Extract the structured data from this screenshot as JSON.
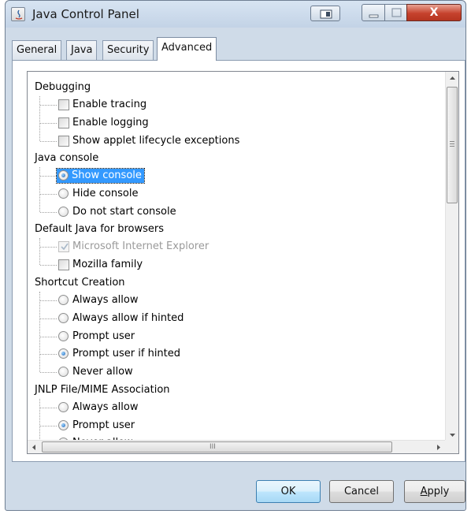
{
  "window": {
    "title": "Java Control Panel",
    "close_glyph": "X"
  },
  "tabs": [
    {
      "label": "General"
    },
    {
      "label": "Java"
    },
    {
      "label": "Security"
    },
    {
      "label": "Advanced",
      "active": true
    }
  ],
  "tree": {
    "debugging": {
      "label": "Debugging",
      "items": [
        {
          "label": "Enable tracing",
          "checked": false
        },
        {
          "label": "Enable logging",
          "checked": false
        },
        {
          "label": "Show applet lifecycle exceptions",
          "checked": false
        }
      ]
    },
    "java_console": {
      "label": "Java console",
      "items": [
        {
          "label": "Show console",
          "selected": true
        },
        {
          "label": "Hide console",
          "selected": false
        },
        {
          "label": "Do not start console",
          "selected": false
        }
      ]
    },
    "default_java": {
      "label": "Default Java for browsers",
      "items": [
        {
          "label": "Microsoft Internet Explorer",
          "checked": true,
          "disabled": true
        },
        {
          "label": "Mozilla family",
          "checked": false
        }
      ]
    },
    "shortcut": {
      "label": "Shortcut Creation",
      "items": [
        {
          "label": "Always allow",
          "selected": false
        },
        {
          "label": "Always allow if hinted",
          "selected": false
        },
        {
          "label": "Prompt user",
          "selected": false
        },
        {
          "label": "Prompt user if hinted",
          "selected": true
        },
        {
          "label": "Never allow",
          "selected": false
        }
      ]
    },
    "jnlp": {
      "label": "JNLP File/MIME Association",
      "items": [
        {
          "label": "Always allow",
          "selected": false
        },
        {
          "label": "Prompt user",
          "selected": true
        },
        {
          "label": "Never allow",
          "selected": false
        }
      ]
    }
  },
  "scrollbar": {
    "h_grip": "III"
  },
  "buttons": {
    "ok": "OK",
    "cancel": "Cancel",
    "apply_first": "A",
    "apply_rest": "pply"
  },
  "colors": {
    "selection": "#3399ff",
    "close_button": "#c6422d"
  }
}
